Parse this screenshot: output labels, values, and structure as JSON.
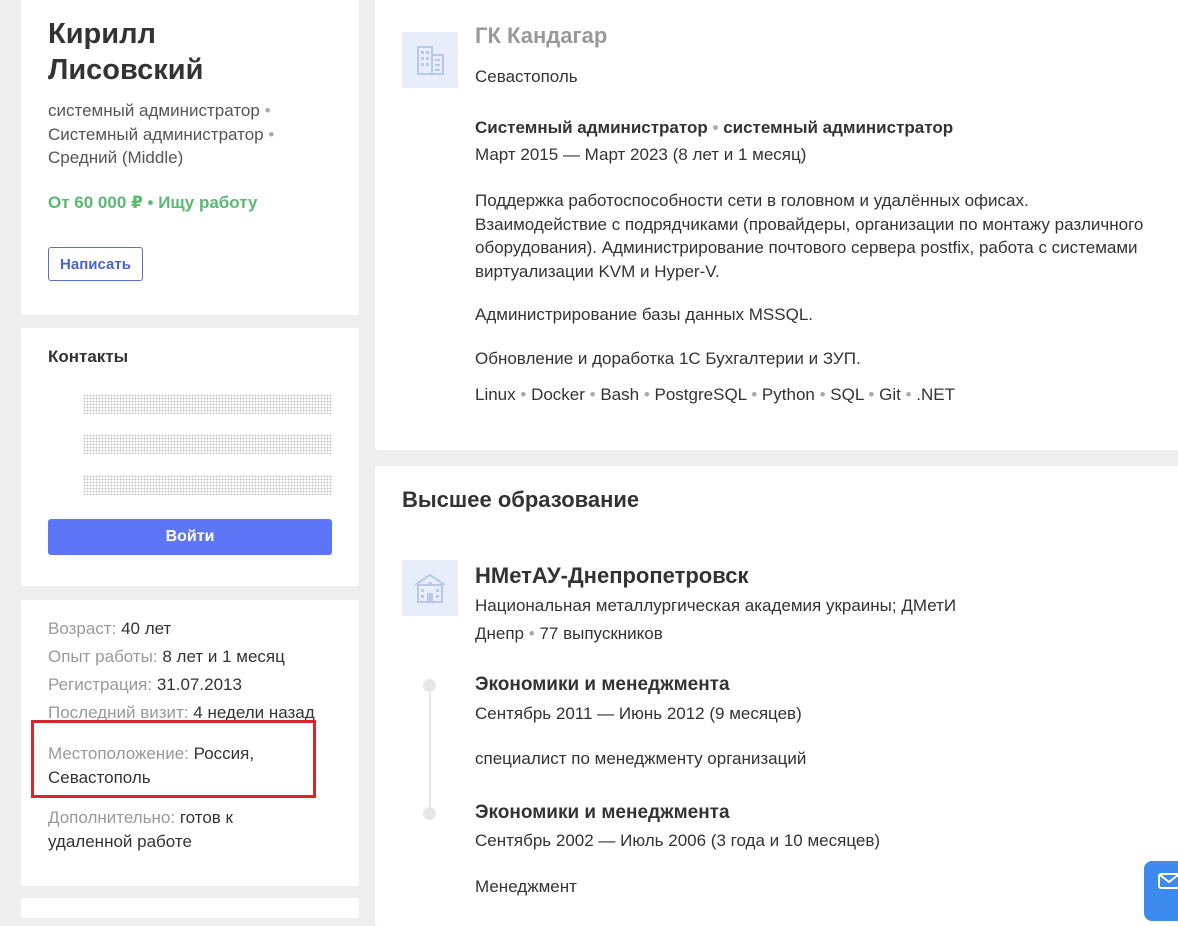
{
  "profile": {
    "name_line1": "Кирилл",
    "name_line2": "Лисовский",
    "spec_line1": "системный администратор",
    "spec_line2": "Системный администратор",
    "spec_line3": "Средний (Middle)",
    "salary": "От 60 000 ₽ • Ищу работу",
    "write_button": "Написать"
  },
  "contacts": {
    "title": "Контакты",
    "login_button": "Войти"
  },
  "details": {
    "age_label": "Возраст:",
    "age_value": "40 лет",
    "experience_label": "Опыт работы:",
    "experience_value": "8 лет и 1 месяц",
    "registration_label": "Регистрация:",
    "registration_value": "31.07.2013",
    "last_visit_label": "Последний визит:",
    "last_visit_value": "4 недели назад",
    "location_label": "Местоположение:",
    "location_value_1": "Россия,",
    "location_value_2": "Севастополь",
    "additional_label": "Дополнительно:",
    "additional_value_1": "готов к",
    "additional_value_2": "удаленной работе"
  },
  "experience": {
    "company": "ГК Кандагар",
    "city": "Севастополь",
    "position": "Системный администратор",
    "position_spec": "системный администратор",
    "period": "Март 2015 — Март 2023 (8 лет и 1 месяц)",
    "desc_lines": [
      "Поддержка работоспособности сети в головном и удалённых офисах.",
      "Взаимодействие с подрядчиками (провайдеры, организации по монтажу различного",
      "оборудования). Администрирование почтового сервера postfix, работа с системами",
      "виртуализации KVM и Hyper-V."
    ],
    "desc2": "Администрирование базы данных MSSQL.",
    "desc3": "Обновление и доработка 1С Бухгалтерии и ЗУП.",
    "skills": [
      "Linux",
      "Docker",
      "Bash",
      "PostgreSQL",
      "Python",
      "SQL",
      "Git",
      ".NET"
    ]
  },
  "education": {
    "section_title": "Высшее образование",
    "university": "НМетАУ-Днепропетровск",
    "university_full": "Национальная металлургическая академия украины; ДМетИ",
    "city": "Днепр",
    "graduates": "77 выпускников",
    "entries": [
      {
        "faculty": "Экономики и менеджмента",
        "period": "Сентябрь 2011 — Июнь 2012 (9 месяцев)",
        "specialty": "специалист по менеджменту организаций"
      },
      {
        "faculty": "Экономики и менеджмента",
        "period": "Сентябрь 2002 — Июль 2006 (3 года и 10 месяцев)",
        "specialty": "Менеджмент"
      }
    ]
  },
  "colors": {
    "accent": "#5d76f7",
    "salary": "#5ab873",
    "highlight": "#d62828"
  }
}
